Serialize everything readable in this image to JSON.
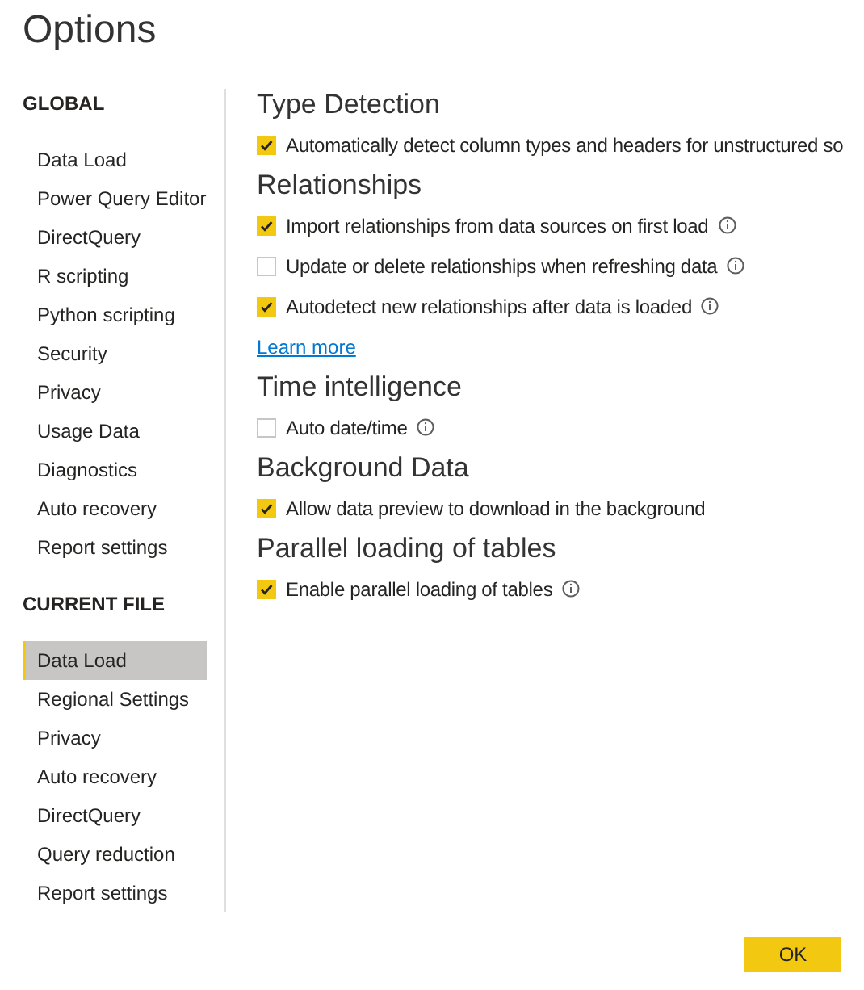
{
  "window": {
    "title": "Options"
  },
  "sidebar": {
    "groups": [
      {
        "heading": "GLOBAL",
        "items": [
          {
            "label": "Data Load",
            "selected": false
          },
          {
            "label": "Power Query Editor",
            "selected": false
          },
          {
            "label": "DirectQuery",
            "selected": false
          },
          {
            "label": "R scripting",
            "selected": false
          },
          {
            "label": "Python scripting",
            "selected": false
          },
          {
            "label": "Security",
            "selected": false
          },
          {
            "label": "Privacy",
            "selected": false
          },
          {
            "label": "Usage Data",
            "selected": false
          },
          {
            "label": "Diagnostics",
            "selected": false
          },
          {
            "label": "Auto recovery",
            "selected": false
          },
          {
            "label": "Report settings",
            "selected": false
          }
        ]
      },
      {
        "heading": "CURRENT FILE",
        "items": [
          {
            "label": "Data Load",
            "selected": true
          },
          {
            "label": "Regional Settings",
            "selected": false
          },
          {
            "label": "Privacy",
            "selected": false
          },
          {
            "label": "Auto recovery",
            "selected": false
          },
          {
            "label": "DirectQuery",
            "selected": false
          },
          {
            "label": "Query reduction",
            "selected": false
          },
          {
            "label": "Report settings",
            "selected": false
          }
        ]
      }
    ]
  },
  "sections": [
    {
      "heading": "Type Detection",
      "items": [
        {
          "kind": "checkbox",
          "label": "Automatically detect column types and headers for unstructured so",
          "checked": true,
          "info": false
        }
      ]
    },
    {
      "heading": "Relationships",
      "items": [
        {
          "kind": "checkbox",
          "label": "Import relationships from data sources on first load",
          "checked": true,
          "info": true
        },
        {
          "kind": "checkbox",
          "label": "Update or delete relationships when refreshing data",
          "checked": false,
          "info": true
        },
        {
          "kind": "checkbox",
          "label": "Autodetect new relationships after data is loaded",
          "checked": true,
          "info": true
        },
        {
          "kind": "link",
          "label": "Learn more"
        }
      ]
    },
    {
      "heading": "Time intelligence",
      "items": [
        {
          "kind": "checkbox",
          "label": "Auto date/time",
          "checked": false,
          "info": true
        }
      ]
    },
    {
      "heading": "Background Data",
      "items": [
        {
          "kind": "checkbox",
          "label": "Allow data preview to download in the background",
          "checked": true,
          "info": false
        }
      ]
    },
    {
      "heading": "Parallel loading of tables",
      "items": [
        {
          "kind": "checkbox",
          "label": "Enable parallel loading of tables",
          "checked": true,
          "info": true
        }
      ]
    }
  ],
  "buttons": [
    {
      "label": "OK"
    }
  ]
}
